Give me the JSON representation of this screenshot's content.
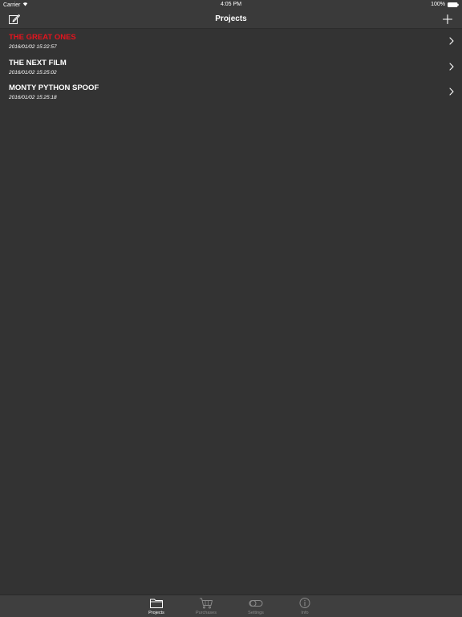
{
  "status_bar": {
    "carrier": "Carrier",
    "time": "4:05 PM",
    "battery": "100%"
  },
  "nav": {
    "title": "Projects",
    "left_icon": "compose-icon",
    "right_icon": "plus-icon"
  },
  "projects": [
    {
      "title": "THE GREAT ONES",
      "date": "2016/01/02 15:22:57",
      "active": true
    },
    {
      "title": "THE NEXT FILM",
      "date": "2016/01/02 15:25:02",
      "active": false
    },
    {
      "title": "MONTY PYTHON SPOOF",
      "date": "2016/01/02 15:25:18",
      "active": false
    }
  ],
  "tabs": [
    {
      "label": "Projects",
      "icon": "folder-icon",
      "selected": true
    },
    {
      "label": "Purchases",
      "icon": "cart-icon",
      "selected": false
    },
    {
      "label": "Settings",
      "icon": "toggle-icon",
      "selected": false
    },
    {
      "label": "Info",
      "icon": "info-icon",
      "selected": false
    }
  ],
  "colors": {
    "background": "#333333",
    "bar": "#3a3a3a",
    "active_title": "#e5141e",
    "inactive_tab": "#8a8a8a"
  }
}
